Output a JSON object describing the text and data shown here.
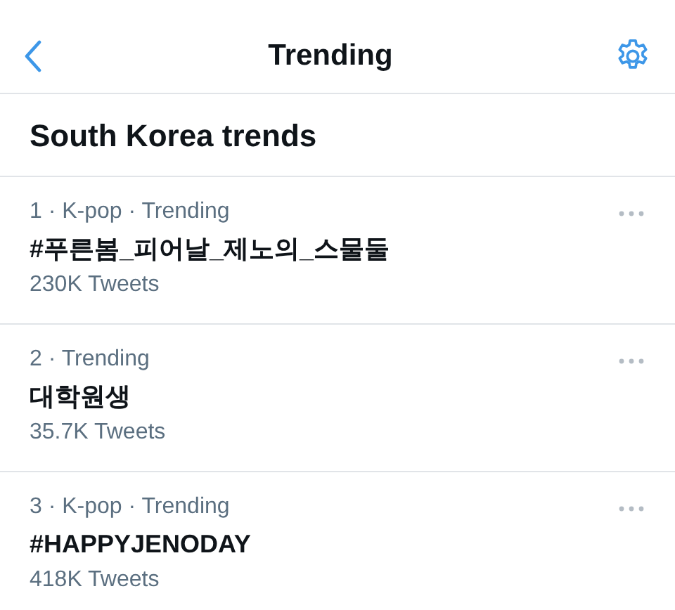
{
  "nav": {
    "title": "Trending"
  },
  "section": {
    "title": "South Korea trends"
  },
  "trends": [
    {
      "meta": "1 · K-pop · Trending",
      "name": "#푸른봄_피어날_제노의_스물둘",
      "count": "230K Tweets"
    },
    {
      "meta": "2 · Trending",
      "name": "대학원생",
      "count": "35.7K Tweets"
    },
    {
      "meta": "3 · K-pop · Trending",
      "name": "#HAPPYJENODAY",
      "count": "418K Tweets"
    }
  ]
}
